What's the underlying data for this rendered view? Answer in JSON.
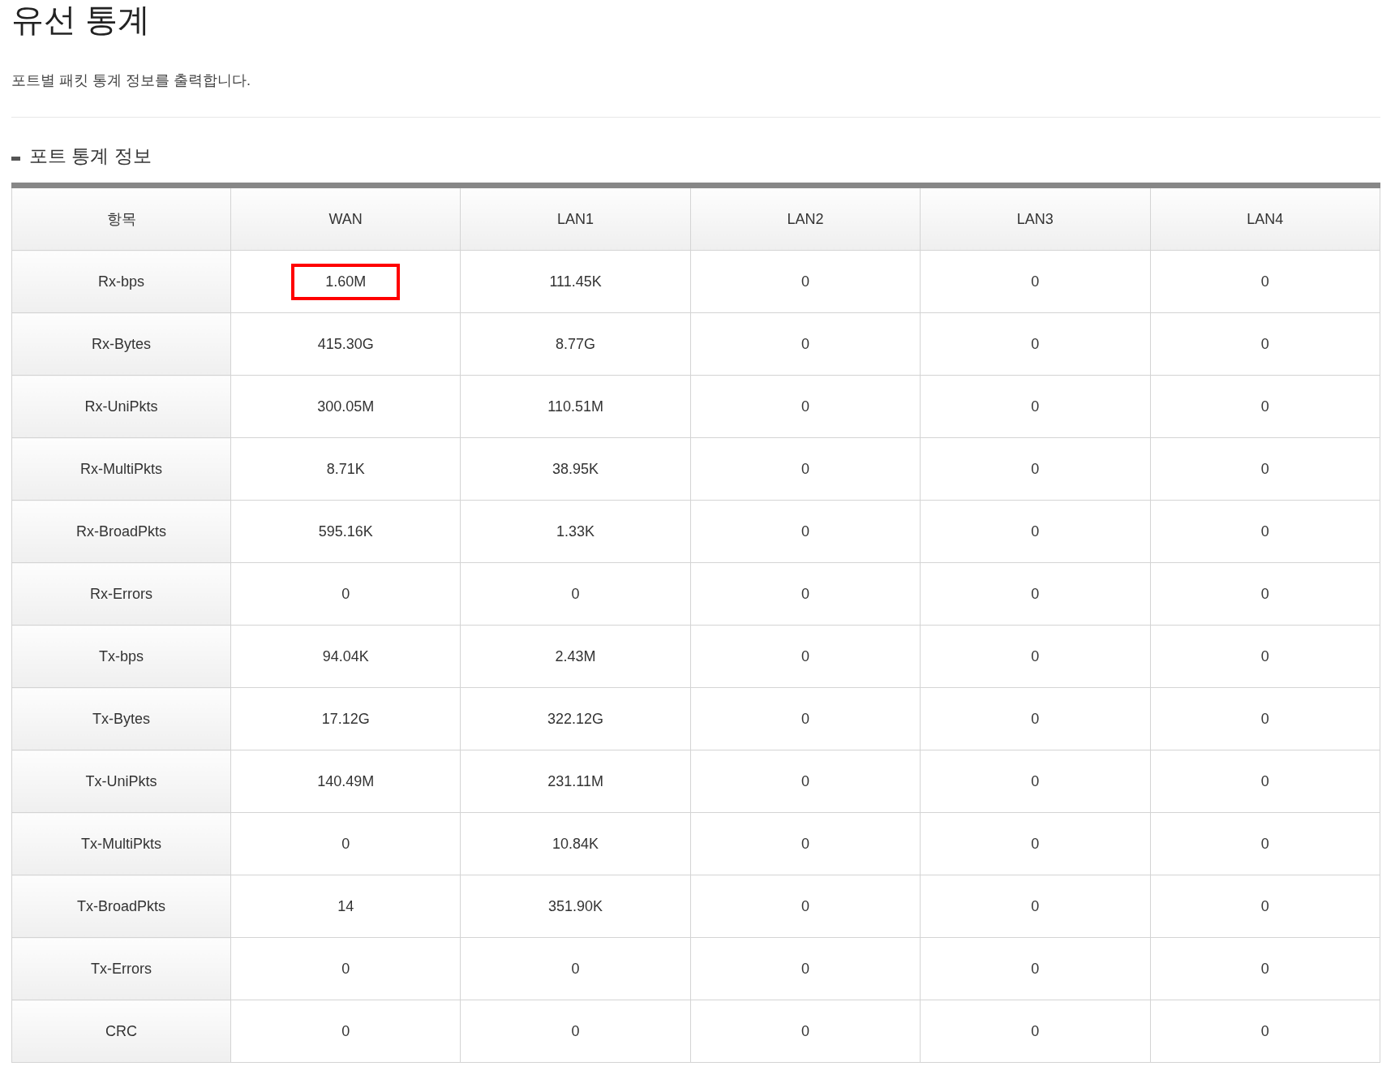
{
  "page": {
    "title": "유선 통계",
    "description": "포트별 패킷 통계 정보를 출력합니다."
  },
  "section": {
    "title": "포트 통계 정보"
  },
  "table": {
    "columns": [
      "항목",
      "WAN",
      "LAN1",
      "LAN2",
      "LAN3",
      "LAN4"
    ],
    "rows": [
      {
        "cells": [
          {
            "value": "Rx-bps",
            "highlighted": false
          },
          {
            "value": "1.60M",
            "highlighted": true
          },
          {
            "value": "111.45K",
            "highlighted": false
          },
          {
            "value": "0",
            "highlighted": false
          },
          {
            "value": "0",
            "highlighted": false
          },
          {
            "value": "0",
            "highlighted": false
          }
        ]
      },
      {
        "cells": [
          {
            "value": "Rx-Bytes",
            "highlighted": false
          },
          {
            "value": "415.30G",
            "highlighted": false
          },
          {
            "value": "8.77G",
            "highlighted": false
          },
          {
            "value": "0",
            "highlighted": false
          },
          {
            "value": "0",
            "highlighted": false
          },
          {
            "value": "0",
            "highlighted": false
          }
        ]
      },
      {
        "cells": [
          {
            "value": "Rx-UniPkts",
            "highlighted": false
          },
          {
            "value": "300.05M",
            "highlighted": false
          },
          {
            "value": "110.51M",
            "highlighted": false
          },
          {
            "value": "0",
            "highlighted": false
          },
          {
            "value": "0",
            "highlighted": false
          },
          {
            "value": "0",
            "highlighted": false
          }
        ]
      },
      {
        "cells": [
          {
            "value": "Rx-MultiPkts",
            "highlighted": false
          },
          {
            "value": "8.71K",
            "highlighted": false
          },
          {
            "value": "38.95K",
            "highlighted": false
          },
          {
            "value": "0",
            "highlighted": false
          },
          {
            "value": "0",
            "highlighted": false
          },
          {
            "value": "0",
            "highlighted": false
          }
        ]
      },
      {
        "cells": [
          {
            "value": "Rx-BroadPkts",
            "highlighted": false
          },
          {
            "value": "595.16K",
            "highlighted": false
          },
          {
            "value": "1.33K",
            "highlighted": false
          },
          {
            "value": "0",
            "highlighted": false
          },
          {
            "value": "0",
            "highlighted": false
          },
          {
            "value": "0",
            "highlighted": false
          }
        ]
      },
      {
        "cells": [
          {
            "value": "Rx-Errors",
            "highlighted": false
          },
          {
            "value": "0",
            "highlighted": false
          },
          {
            "value": "0",
            "highlighted": false
          },
          {
            "value": "0",
            "highlighted": false
          },
          {
            "value": "0",
            "highlighted": false
          },
          {
            "value": "0",
            "highlighted": false
          }
        ]
      },
      {
        "cells": [
          {
            "value": "Tx-bps",
            "highlighted": false
          },
          {
            "value": "94.04K",
            "highlighted": false
          },
          {
            "value": "2.43M",
            "highlighted": false
          },
          {
            "value": "0",
            "highlighted": false
          },
          {
            "value": "0",
            "highlighted": false
          },
          {
            "value": "0",
            "highlighted": false
          }
        ]
      },
      {
        "cells": [
          {
            "value": "Tx-Bytes",
            "highlighted": false
          },
          {
            "value": "17.12G",
            "highlighted": false
          },
          {
            "value": "322.12G",
            "highlighted": false
          },
          {
            "value": "0",
            "highlighted": false
          },
          {
            "value": "0",
            "highlighted": false
          },
          {
            "value": "0",
            "highlighted": false
          }
        ]
      },
      {
        "cells": [
          {
            "value": "Tx-UniPkts",
            "highlighted": false
          },
          {
            "value": "140.49M",
            "highlighted": false
          },
          {
            "value": "231.11M",
            "highlighted": false
          },
          {
            "value": "0",
            "highlighted": false
          },
          {
            "value": "0",
            "highlighted": false
          },
          {
            "value": "0",
            "highlighted": false
          }
        ]
      },
      {
        "cells": [
          {
            "value": "Tx-MultiPkts",
            "highlighted": false
          },
          {
            "value": "0",
            "highlighted": false
          },
          {
            "value": "10.84K",
            "highlighted": false
          },
          {
            "value": "0",
            "highlighted": false
          },
          {
            "value": "0",
            "highlighted": false
          },
          {
            "value": "0",
            "highlighted": false
          }
        ]
      },
      {
        "cells": [
          {
            "value": "Tx-BroadPkts",
            "highlighted": false
          },
          {
            "value": "14",
            "highlighted": false
          },
          {
            "value": "351.90K",
            "highlighted": false
          },
          {
            "value": "0",
            "highlighted": false
          },
          {
            "value": "0",
            "highlighted": false
          },
          {
            "value": "0",
            "highlighted": false
          }
        ]
      },
      {
        "cells": [
          {
            "value": "Tx-Errors",
            "highlighted": false
          },
          {
            "value": "0",
            "highlighted": false
          },
          {
            "value": "0",
            "highlighted": false
          },
          {
            "value": "0",
            "highlighted": false
          },
          {
            "value": "0",
            "highlighted": false
          },
          {
            "value": "0",
            "highlighted": false
          }
        ]
      },
      {
        "cells": [
          {
            "value": "CRC",
            "highlighted": false
          },
          {
            "value": "0",
            "highlighted": false
          },
          {
            "value": "0",
            "highlighted": false
          },
          {
            "value": "0",
            "highlighted": false
          },
          {
            "value": "0",
            "highlighted": false
          },
          {
            "value": "0",
            "highlighted": false
          }
        ]
      }
    ]
  }
}
